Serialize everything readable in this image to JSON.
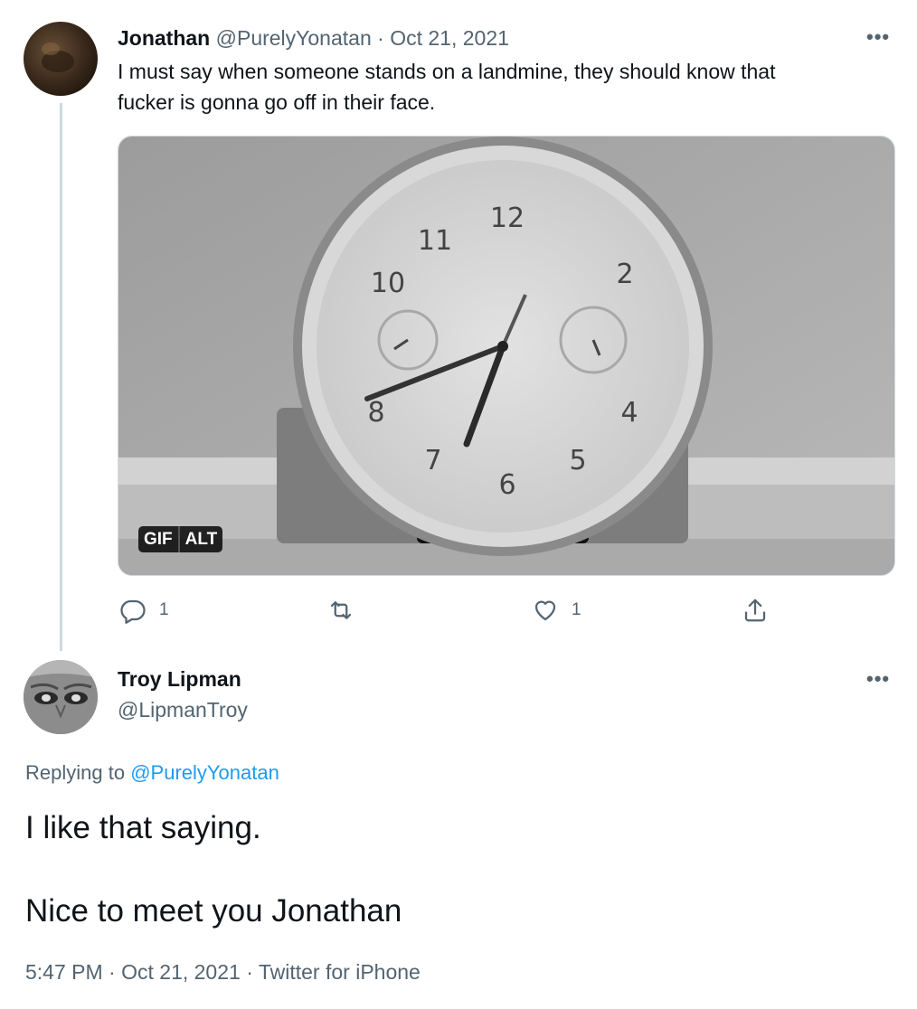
{
  "tweet": {
    "author_name": "Jonathan",
    "author_handle": "@PurelyYonatan",
    "separator": "·",
    "date": "Oct 21, 2021",
    "text_line1": "I must say when someone stands on a landmine, they should know that",
    "text_line2": "fucker is gonna go off in their face.",
    "media": {
      "gif_badge": "GIF",
      "alt_badge": "ALT"
    },
    "actions": {
      "reply_count": "1",
      "like_count": "1"
    }
  },
  "reply": {
    "author_name": "Troy Lipman",
    "author_handle": "@LipmanTroy",
    "replying_prefix": "Replying to",
    "replying_to": "@PurelyYonatan",
    "text_line1": "I like that saying.",
    "text_line2": "Nice to meet you Jonathan",
    "time": "5:47 PM",
    "date": "Oct 21, 2021",
    "source": "Twitter for iPhone",
    "separator": "·"
  },
  "icons": [
    "more-icon",
    "reply-icon",
    "retweet-icon",
    "like-icon",
    "share-icon"
  ],
  "colors": {
    "link": "#1d9bf0",
    "muted": "#536471",
    "text": "#0f1419",
    "line": "#cfd9de"
  }
}
